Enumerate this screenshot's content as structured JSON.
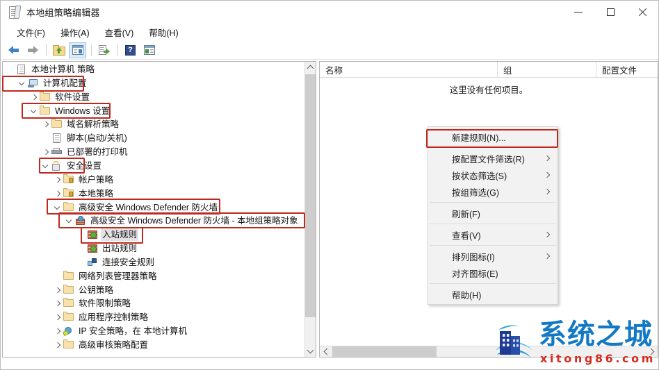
{
  "window": {
    "title": "本地组策略编辑器",
    "icon": "policy-document-icon",
    "controls": {
      "minimize": "—",
      "maximize": "□",
      "close": "✕"
    }
  },
  "menubar": {
    "items": [
      {
        "label": "文件(F)",
        "name": "menu-file"
      },
      {
        "label": "操作(A)",
        "name": "menu-action"
      },
      {
        "label": "查看(V)",
        "name": "menu-view"
      },
      {
        "label": "帮助(H)",
        "name": "menu-help"
      }
    ]
  },
  "toolbar": {
    "buttons": [
      {
        "name": "back-arrow-icon",
        "tip": "后退"
      },
      {
        "name": "forward-arrow-icon",
        "tip": "前进"
      },
      {
        "name": "folder-up-icon",
        "tip": "上移一级"
      },
      {
        "name": "show-hide-console-tree-icon",
        "tip": "显示/隐藏控制台树",
        "selected": true
      },
      {
        "name": "export-list-icon",
        "tip": "导出列表"
      },
      {
        "name": "help-icon",
        "tip": "帮助",
        "glyph": "?"
      },
      {
        "name": "show-action-pane-icon",
        "tip": "显示/隐藏操作窗格"
      }
    ]
  },
  "tree": {
    "nodes": [
      {
        "label": "本地计算机 策略",
        "icon": "policy-document-icon",
        "indent": 0,
        "chevron": "none",
        "highlight": false,
        "selected": false
      },
      {
        "label": "计算机配置",
        "icon": "computer-icon",
        "indent": 1,
        "chevron": "open",
        "highlight": true,
        "selected": false
      },
      {
        "label": "软件设置",
        "icon": "folder-icon",
        "indent": 2,
        "chevron": "collapsed",
        "highlight": false,
        "selected": false
      },
      {
        "label": "Windows 设置",
        "icon": "folder-icon",
        "indent": 2,
        "chevron": "open",
        "highlight": true,
        "selected": false
      },
      {
        "label": "域名解析策略",
        "icon": "folder-icon",
        "indent": 3,
        "chevron": "collapsed",
        "highlight": false,
        "selected": false
      },
      {
        "label": "脚本(启动/关机)",
        "icon": "script-document-icon",
        "indent": 3,
        "chevron": "none",
        "highlight": false,
        "selected": false
      },
      {
        "label": "已部署的打印机",
        "icon": "printer-icon",
        "indent": 3,
        "chevron": "collapsed",
        "highlight": false,
        "selected": false
      },
      {
        "label": "安全设置",
        "icon": "security-lock-icon",
        "indent": 3,
        "chevron": "open",
        "highlight": true,
        "selected": false
      },
      {
        "label": "帐户策略",
        "icon": "folder-lock-icon",
        "indent": 4,
        "chevron": "collapsed",
        "highlight": false,
        "selected": false
      },
      {
        "label": "本地策略",
        "icon": "folder-lock-icon",
        "indent": 4,
        "chevron": "collapsed",
        "highlight": false,
        "selected": false
      },
      {
        "label": "高级安全 Windows Defender 防火墙",
        "icon": "folder-icon",
        "indent": 4,
        "chevron": "open",
        "highlight": true,
        "selected": false
      },
      {
        "label": "高级安全 Windows Defender 防火墙 - 本地组策略对象",
        "icon": "firewall-icon",
        "indent": 5,
        "chevron": "open",
        "highlight": true,
        "selected": false
      },
      {
        "label": "入站规则",
        "icon": "inbound-rule-icon",
        "indent": 6,
        "chevron": "none",
        "highlight": true,
        "selected": true
      },
      {
        "label": "出站规则",
        "icon": "outbound-rule-icon",
        "indent": 6,
        "chevron": "none",
        "highlight": false,
        "selected": false
      },
      {
        "label": "连接安全规则",
        "icon": "connection-security-rule-icon",
        "indent": 6,
        "chevron": "none",
        "highlight": false,
        "selected": false
      },
      {
        "label": "网络列表管理器策略",
        "icon": "folder-icon",
        "indent": 4,
        "chevron": "none",
        "highlight": false,
        "selected": false
      },
      {
        "label": "公钥策略",
        "icon": "folder-icon",
        "indent": 4,
        "chevron": "collapsed",
        "highlight": false,
        "selected": false
      },
      {
        "label": "软件限制策略",
        "icon": "folder-icon",
        "indent": 4,
        "chevron": "collapsed",
        "highlight": false,
        "selected": false
      },
      {
        "label": "应用程序控制策略",
        "icon": "folder-icon",
        "indent": 4,
        "chevron": "collapsed",
        "highlight": false,
        "selected": false
      },
      {
        "label": "IP 安全策略，在 本地计算机",
        "icon": "ip-security-icon",
        "indent": 4,
        "chevron": "collapsed",
        "highlight": false,
        "selected": false
      },
      {
        "label": "高级审核策略配置",
        "icon": "folder-icon",
        "indent": 4,
        "chevron": "collapsed",
        "highlight": false,
        "selected": false
      }
    ]
  },
  "list": {
    "columns": [
      {
        "label": "名称",
        "name": "column-name"
      },
      {
        "label": "组",
        "name": "column-group"
      },
      {
        "label": "配置文件",
        "name": "column-profile"
      }
    ],
    "empty_text": "这里没有任何项目。"
  },
  "context_menu": {
    "items": [
      {
        "label": "新建规则(N)...",
        "name": "ctx-new-rule",
        "submenu": false,
        "highlight": true
      },
      {
        "separator": false,
        "label": "按配置文件筛选(R)",
        "name": "ctx-filter-by-profile",
        "submenu": true,
        "highlight": false
      },
      {
        "label": "按状态筛选(S)",
        "name": "ctx-filter-by-state",
        "submenu": true,
        "highlight": false
      },
      {
        "label": "按组筛选(G)",
        "name": "ctx-filter-by-group",
        "submenu": true,
        "highlight": false
      },
      {
        "label": "刷新(F)",
        "name": "ctx-refresh",
        "submenu": false,
        "highlight": false
      },
      {
        "label": "查看(V)",
        "name": "ctx-view",
        "submenu": true,
        "highlight": false
      },
      {
        "label": "排列图标(I)",
        "name": "ctx-arrange-icons",
        "submenu": true,
        "highlight": false
      },
      {
        "label": "对齐图标(E)",
        "name": "ctx-align-icons",
        "submenu": false,
        "highlight": false
      },
      {
        "label": "帮助(H)",
        "name": "ctx-help",
        "submenu": false,
        "highlight": false
      }
    ]
  },
  "watermark": {
    "title": "系统之城",
    "domain": "xitong86.com"
  },
  "colors": {
    "annotation_red": "#c0281f",
    "watermark_blue": "#1479c4",
    "watermark_red": "#d82b1e",
    "selection_gray": "#e3e3e3"
  }
}
